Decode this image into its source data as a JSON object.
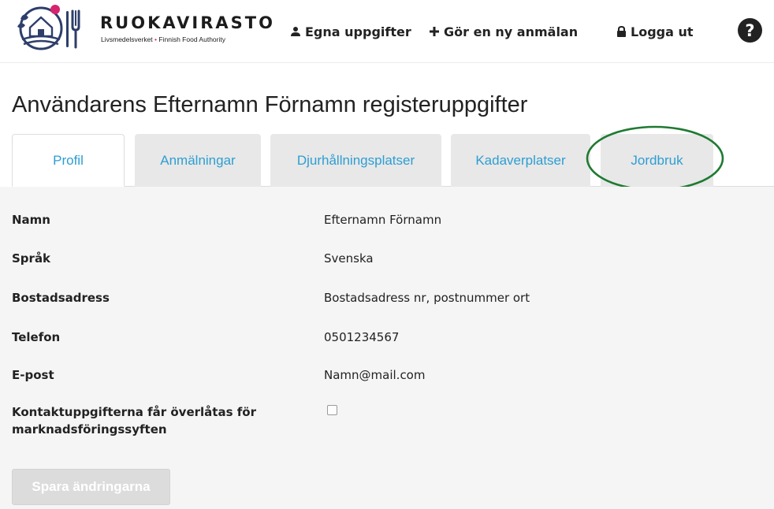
{
  "header": {
    "brand_name": "RUOKAVIRASTO",
    "brand_sub_left": "Livsmedelsverket",
    "brand_sub_dot": "•",
    "brand_sub_right": "Finnish Food Authority",
    "nav": {
      "own_info": "Egna uppgifter",
      "new_report": "Gör en ny anmälan",
      "logout": "Logga ut",
      "help": "?"
    }
  },
  "page": {
    "title": "Användarens Efternamn Förnamn registeruppgifter"
  },
  "tabs": [
    {
      "label": "Profil",
      "active": true
    },
    {
      "label": "Anmälningar",
      "active": false
    },
    {
      "label": "Djurhållningsplatser",
      "active": false
    },
    {
      "label": "Kadaverplatser",
      "active": false
    },
    {
      "label": "Jordbruk",
      "active": false,
      "highlighted": true
    }
  ],
  "profile": {
    "fields": [
      {
        "label": "Namn",
        "value": "Efternamn Förnamn"
      },
      {
        "label": "Språk",
        "value": "Svenska"
      },
      {
        "label": "Bostadsadress",
        "value": "Bostadsadress nr, postnummer ort"
      },
      {
        "label": "Telefon",
        "value": "0501234567"
      },
      {
        "label": "E-post",
        "value": "Namn@mail.com"
      }
    ],
    "marketing_label_line1": "Kontaktuppgifterna får överlåtas för",
    "marketing_label_line2": "marknadsföringssyften",
    "marketing_consent": false,
    "save_label": "Spara ändringarna"
  },
  "colors": {
    "tab_text": "#2e9ed2",
    "highlight_ellipse": "#1f7a32",
    "brand_dot": "#d6246e"
  },
  "icons": {
    "own_info": "user-icon",
    "new_report": "plus-icon",
    "logout": "lock-icon",
    "help": "question-circle-icon"
  }
}
